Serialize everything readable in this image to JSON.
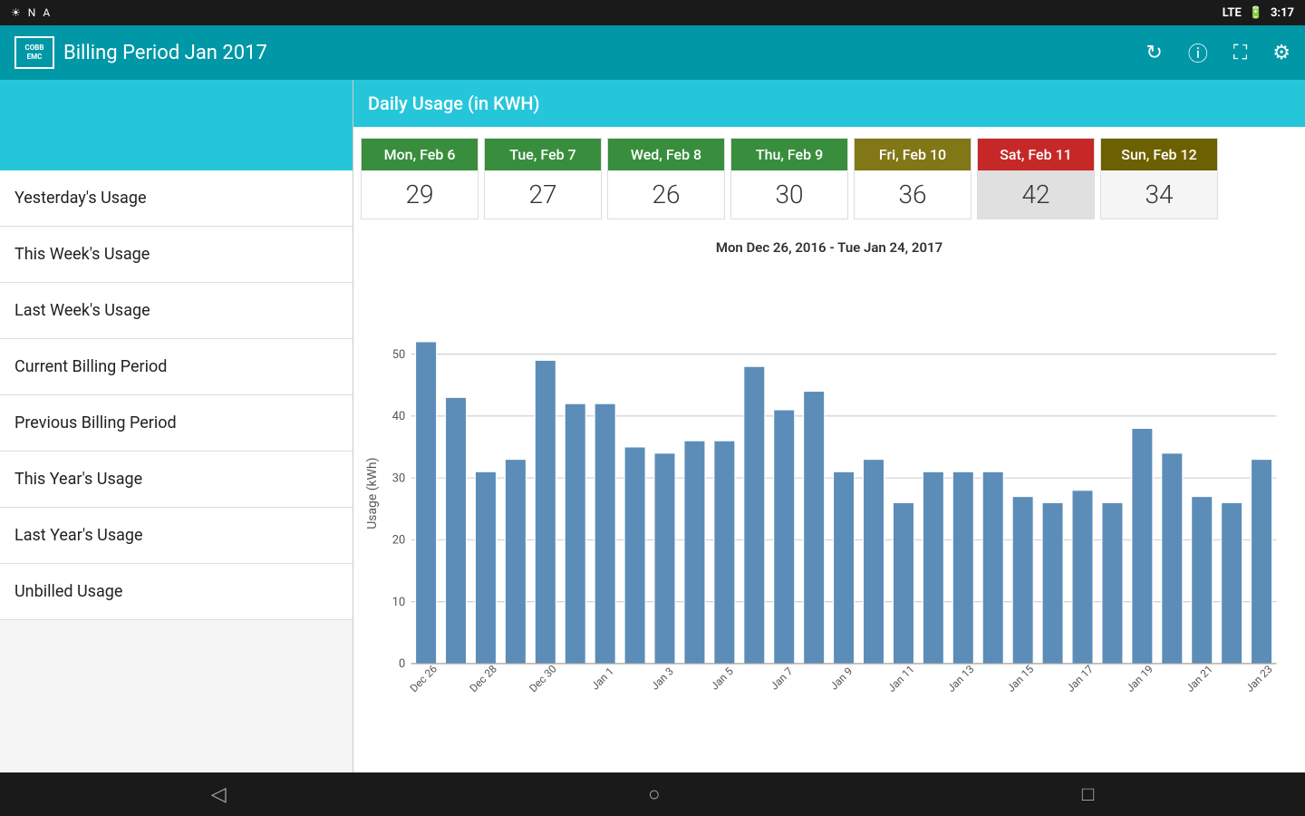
{
  "statusBar": {
    "leftIcons": [
      "☀",
      "N",
      "A"
    ],
    "time": "3:17",
    "batteryIcon": "🔋"
  },
  "titleBar": {
    "logoLine1": "COBB",
    "logoLine2": "EMC",
    "title": "Billing Period Jan 2017",
    "icons": [
      "refresh",
      "info",
      "fullscreen",
      "settings"
    ]
  },
  "dailyUsage": {
    "header": "Daily Usage (in KWH)",
    "days": [
      {
        "label": "Mon, Feb 6",
        "value": "29",
        "colorClass": "green-bg"
      },
      {
        "label": "Tue, Feb 7",
        "value": "27",
        "colorClass": "green-bg"
      },
      {
        "label": "Wed, Feb 8",
        "value": "26",
        "colorClass": "green-bg"
      },
      {
        "label": "Thu, Feb 9",
        "value": "30",
        "colorClass": "green-bg"
      },
      {
        "label": "Fri, Feb 10",
        "value": "36",
        "colorClass": "olive-bg"
      },
      {
        "label": "Sat, Feb 11",
        "value": "42",
        "colorClass": "red-bg"
      },
      {
        "label": "Sun, Feb 12",
        "value": "34",
        "colorClass": "dark-olive"
      }
    ]
  },
  "chart": {
    "dateRange": "Mon Dec 26, 2016 - Tue Jan 24, 2017",
    "yLabel": "Usage (kWh)",
    "yMax": 50,
    "yTicks": [
      0,
      10,
      20,
      30,
      40,
      50
    ],
    "xLabels": [
      "Dec 26",
      "Dec 28",
      "Dec 30",
      "Jan 1",
      "Jan 3",
      "Jan 5",
      "Jan 7",
      "Jan 9",
      "Jan 11",
      "Jan 13",
      "Jan 15",
      "Jan 17",
      "Jan 19",
      "Jan 21",
      "Jan 23"
    ],
    "bars": [
      52,
      43,
      31,
      33,
      49,
      42,
      42,
      35,
      34,
      36,
      36,
      48,
      41,
      44,
      31,
      33,
      26,
      31,
      31,
      31,
      27,
      26,
      28,
      26,
      38,
      34,
      27,
      26,
      33
    ]
  },
  "sidebar": {
    "items": [
      "Yesterday's Usage",
      "This Week's Usage",
      "Last Week's Usage",
      "Current Billing Period",
      "Previous Billing Period",
      "This Year's Usage",
      "Last Year's Usage",
      "Unbilled Usage"
    ]
  },
  "bottomNav": {
    "icons": [
      "◁",
      "○",
      "□"
    ]
  }
}
